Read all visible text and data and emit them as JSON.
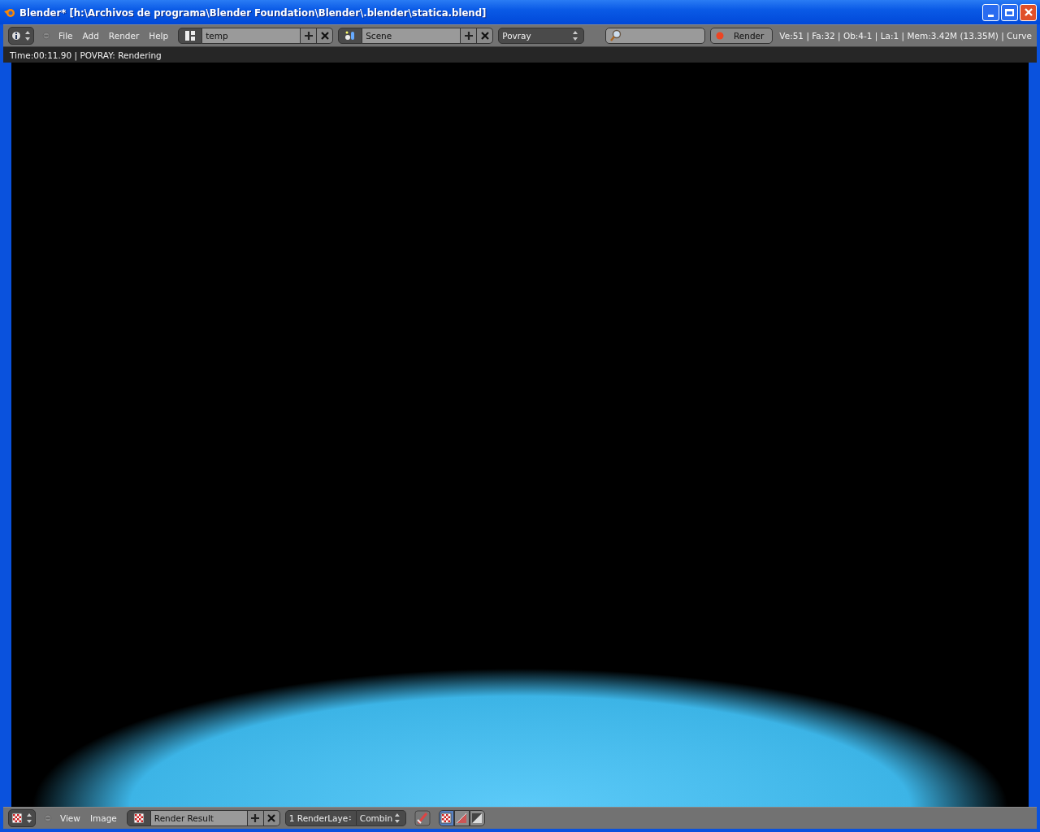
{
  "window": {
    "title": "Blender* [h:\\Archivos de programa\\Blender Foundation\\Blender\\.blender\\statica.blend]"
  },
  "top_header": {
    "menus": [
      "File",
      "Add",
      "Render",
      "Help"
    ],
    "screen": {
      "value": "temp"
    },
    "scene": {
      "value": "Scene"
    },
    "engine": "Povray",
    "render_button": "Render",
    "stats": "Ve:51 | Fa:32 | Ob:4-1 | La:1 | Mem:3.42M (13.35M) | Curve"
  },
  "info_line": "Time:00:11.90 | POVRAY: Rendering",
  "image_header": {
    "menus": [
      "View",
      "Image"
    ],
    "image": {
      "value": "Render Result"
    },
    "layer": "1 RenderLaye",
    "pass": "Combin",
    "draw_modes": [
      {
        "selected": true
      },
      {
        "selected": false
      },
      {
        "selected": false
      }
    ]
  }
}
